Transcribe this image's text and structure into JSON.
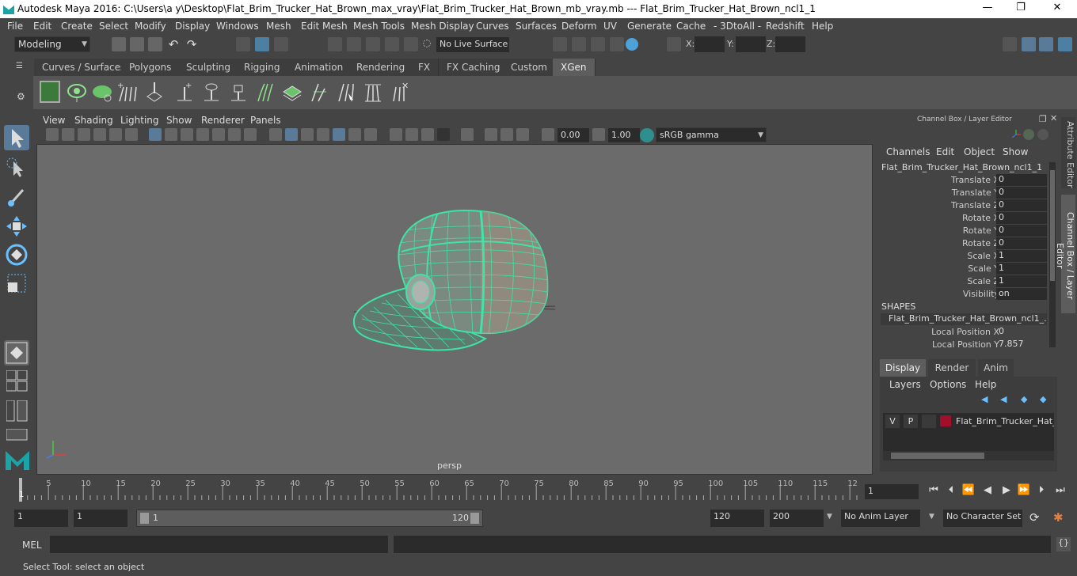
{
  "window": {
    "title": "Autodesk Maya 2016: C:\\Users\\a y\\Desktop\\Flat_Brim_Trucker_Hat_Brown_max_vray\\Flat_Brim_Trucker_Hat_Brown_mb_vray.mb   ---   Flat_Brim_Trucker_Hat_Brown_ncl1_1",
    "minimize": "—",
    "maximize": "❐",
    "close": "✕"
  },
  "menubar": [
    "File",
    "Edit",
    "Create",
    "Select",
    "Modify",
    "Display",
    "Windows",
    "Mesh",
    "Edit Mesh",
    "Mesh Tools",
    "Mesh Display",
    "Curves",
    "Surfaces",
    "Deform",
    "UV",
    "Generate",
    "Cache",
    "- 3DtoAll -",
    "Redshift",
    "Help"
  ],
  "status": {
    "mode": "Modeling",
    "live_surface": "No Live Surface",
    "x_label": "X:",
    "y_label": "Y:",
    "z_label": "Z:"
  },
  "shelf": {
    "tabs": [
      "Curves / Surfaces",
      "Polygons",
      "Sculpting",
      "Rigging",
      "Animation",
      "Rendering",
      "FX",
      "FX Caching",
      "Custom",
      "XGen"
    ],
    "active_tab": "XGen"
  },
  "viewport": {
    "menus": [
      "View",
      "Shading",
      "Lighting",
      "Show",
      "Renderer",
      "Panels"
    ],
    "exposure": "0.00",
    "gamma": "1.00",
    "colorspace": "sRGB gamma",
    "camera": "persp"
  },
  "channel_box": {
    "header": "Channel Box / Layer Editor",
    "menus": [
      "Channels",
      "Edit",
      "Object",
      "Show"
    ],
    "object_name": "Flat_Brim_Trucker_Hat_Brown_ncl1_1",
    "attributes": [
      {
        "label": "Translate X",
        "value": "0"
      },
      {
        "label": "Translate Y",
        "value": "0"
      },
      {
        "label": "Translate Z",
        "value": "0"
      },
      {
        "label": "Rotate X",
        "value": "0"
      },
      {
        "label": "Rotate Y",
        "value": "0"
      },
      {
        "label": "Rotate Z",
        "value": "0"
      },
      {
        "label": "Scale X",
        "value": "1"
      },
      {
        "label": "Scale Y",
        "value": "1"
      },
      {
        "label": "Scale Z",
        "value": "1"
      },
      {
        "label": "Visibility",
        "value": "on"
      }
    ],
    "shapes_header": "SHAPES",
    "shape_name": "Flat_Brim_Trucker_Hat_Brown_ncl1_...",
    "shape_attributes": [
      {
        "label": "Local Position X",
        "value": "0"
      },
      {
        "label": "Local Position Y",
        "value": "7.857"
      }
    ]
  },
  "layer_editor": {
    "tabs": [
      "Display",
      "Render",
      "Anim"
    ],
    "active_tab": "Display",
    "menus": [
      "Layers",
      "Options",
      "Help"
    ],
    "layer": {
      "v": "V",
      "p": "P",
      "name": "Flat_Brim_Trucker_Hat_Br",
      "color": "#a0102a"
    }
  },
  "side_tabs": [
    "Attribute Editor",
    "Channel Box / Layer Editor"
  ],
  "timeline": {
    "ticks": [
      "5",
      "10",
      "15",
      "20",
      "25",
      "30",
      "35",
      "40",
      "45",
      "50",
      "55",
      "60",
      "65",
      "70",
      "75",
      "80",
      "85",
      "90",
      "95",
      "100",
      "105",
      "110",
      "115",
      "12"
    ],
    "current_marker": "1",
    "current_frame": "1"
  },
  "range": {
    "start": "1",
    "playback_start": "1",
    "slider_start": "1",
    "slider_end": "120",
    "playback_end": "120",
    "end": "200",
    "anim_layer": "No Anim Layer",
    "character_set": "No Character Set"
  },
  "cmdline": {
    "label": "MEL"
  },
  "helpline": {
    "text": "Select Tool: select an object"
  },
  "colors": {
    "wire": "#3fe3a6",
    "layer": "#a0102a",
    "accent": "#4da3d8"
  }
}
